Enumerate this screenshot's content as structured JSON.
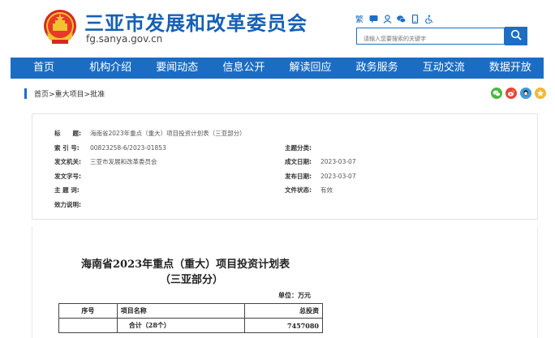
{
  "header": {
    "site_title": "三亚市发展和改革委员会",
    "site_url": "fg.sanya.gov.cn",
    "search_placeholder": "请输入您要搜索的关键字",
    "tool_icons": [
      "traditional-chinese-icon",
      "message-icon",
      "user-icon",
      "wechat-icon",
      "mobile-icon",
      "accessibility-icon"
    ],
    "brand_color": "#1560b5"
  },
  "nav": {
    "items": [
      "首页",
      "机构介绍",
      "要闻动态",
      "信息公开",
      "解读回应",
      "政务服务",
      "互动交流",
      "数据开放"
    ],
    "color": "#1b6dc4"
  },
  "breadcrumb": {
    "text": "首页>重大项目>批准"
  },
  "share_icons": [
    "wechat-share-icon",
    "weibo-share-icon",
    "qq-share-icon",
    "qzone-share-icon"
  ],
  "meta": {
    "title_label": "标　　题:",
    "title_value": "海南省2023年重点（重大）项目投资计划表（三亚部分）",
    "index_label": "索 引 号:",
    "index_value": "00823258-6/2023-01853",
    "category_label": "主题分类:",
    "category_value": "",
    "issuer_label": "发文机关:",
    "issuer_value": "三亚市发展和改革委员会",
    "created_label": "成文日期:",
    "created_value": "2023-03-07",
    "docno_label": "发文字号:",
    "docno_value": "",
    "published_label": "发布日期:",
    "published_value": "2023-03-07",
    "subject_label": "主 题 词:",
    "subject_value": "",
    "status_label": "文件状态:",
    "status_value": "有效",
    "validity_label": "效力说明:",
    "validity_value": ""
  },
  "document": {
    "title_line1": "海南省2023年重点（重大）项目投资计划表",
    "title_line2": "（三亚部分）",
    "unit": "单位：万元",
    "table": {
      "headers": [
        "序号",
        "项目名称",
        "总投资"
      ],
      "rows": [
        {
          "no": "",
          "name": "合计（28个）",
          "total": "7457080"
        }
      ]
    }
  }
}
